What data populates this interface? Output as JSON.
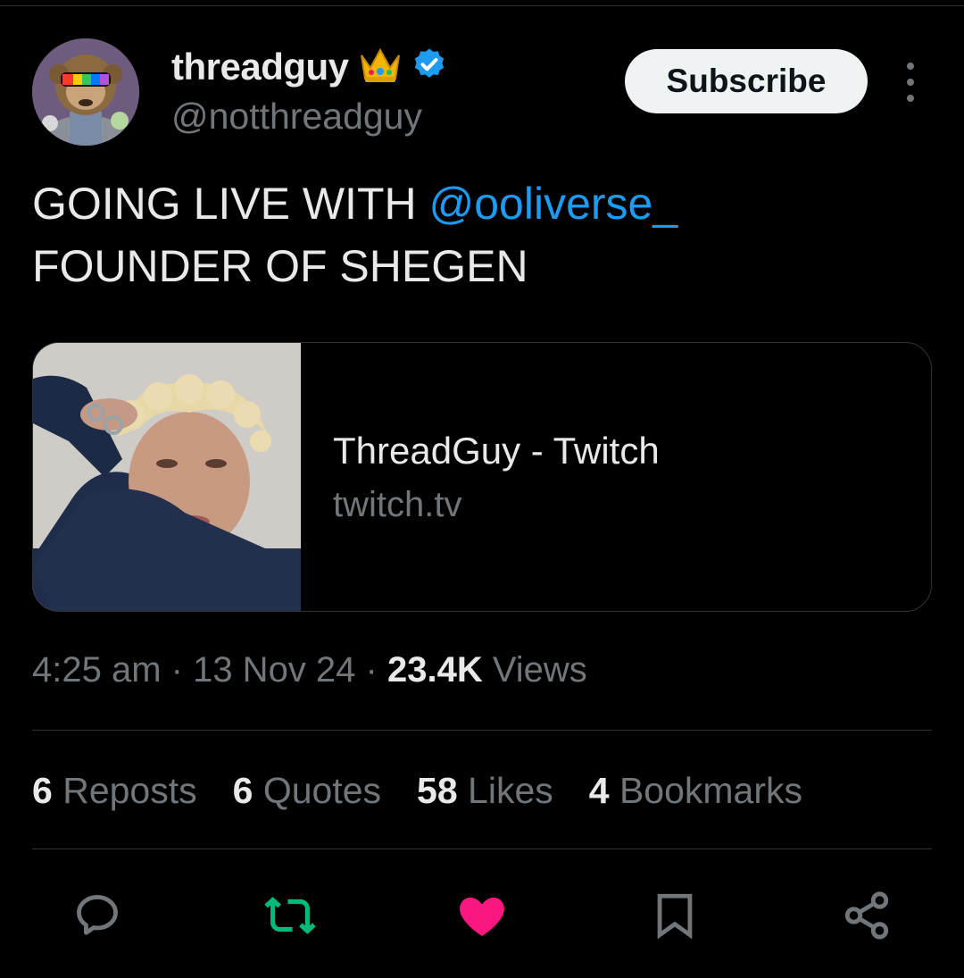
{
  "author": {
    "display_name": "threadguy",
    "handle": "@notthreadguy",
    "badges": [
      "crown-emoji",
      "verified-badge"
    ]
  },
  "header": {
    "subscribe_label": "Subscribe"
  },
  "tweet": {
    "text_before_mention": "GOING LIVE WITH ",
    "mention": "@ooliverse_",
    "text_line2": "FOUNDER OF SHEGEN"
  },
  "card": {
    "title": "ThreadGuy - Twitch",
    "domain": "twitch.tv"
  },
  "meta": {
    "time": "4:25 am",
    "separator1": " · ",
    "date": "13 Nov 24",
    "separator2": " · ",
    "views_count": "23.4K",
    "views_label": " Views"
  },
  "stats": [
    {
      "count": "6",
      "label": " Reposts"
    },
    {
      "count": "6",
      "label": " Quotes"
    },
    {
      "count": "58",
      "label": " Likes"
    },
    {
      "count": "4",
      "label": " Bookmarks"
    }
  ],
  "actions": {
    "reply_icon": "reply-icon",
    "repost_icon": "repost-icon",
    "like_icon": "heart-icon",
    "bookmark_icon": "bookmark-icon",
    "share_icon": "share-icon"
  },
  "colors": {
    "background": "#000000",
    "mention": "#1d9bf0",
    "repost_active": "#00ba7c",
    "like_active": "#f91880",
    "secondary_text": "#71767b",
    "verified": "#1d9bf0",
    "crown": "#f4b400"
  }
}
